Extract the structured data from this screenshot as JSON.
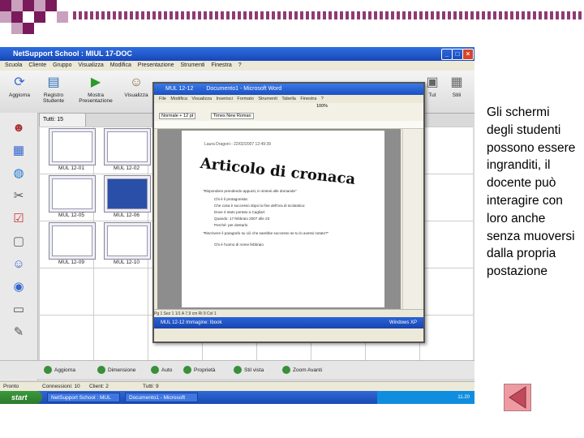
{
  "slide": {
    "caption": "Gli schermi degli studenti possono essere ingranditi, il docente può interagire con loro anche senza muoversi dalla propria postazione",
    "colors": {
      "accent": "#7a1a5a",
      "nav_button": "#ee9aa2"
    },
    "nav_icon": "previous-triangle-icon"
  },
  "app": {
    "title": "NetSupport School : MIUL 17-DOC",
    "menu": [
      "Scuola",
      "Cliente",
      "Gruppo",
      "Visualizza",
      "Modifica",
      "Presentazione",
      "Strumenti",
      "Finestra",
      "?"
    ],
    "toolbar": [
      {
        "label": "Aggiorna",
        "icon": "refresh-icon"
      },
      {
        "label": "Registro Studente",
        "icon": "register-icon"
      },
      {
        "label": "Mostra Presentazione",
        "icon": "play-icon"
      },
      {
        "label": "Visualizza",
        "icon": "view-icon"
      }
    ],
    "right_toolbar": [
      {
        "label": "Tut"
      },
      {
        "label": "Stili"
      }
    ],
    "tab_label": "Tutti: 15",
    "thumbnails": [
      "MUL 12-01",
      "MUL 12-02",
      "MUL 12-05",
      "MUL 12-06",
      "MUL 12-09",
      "MUL 12-10"
    ],
    "bottom_buttons": [
      "Aggiorna",
      "Dimensione",
      "Auto",
      "Proprietà",
      "Stil vista",
      "Zoom Avanti"
    ],
    "status": {
      "ready": "Pronto",
      "connections": "Connessioni: 10",
      "clients": "Client: 2",
      "total": "Tutti: 9"
    },
    "taskbar": {
      "start": "start",
      "tasks": [
        "NetSupport School : MUL 17-D...",
        "Documento1 - Microsoft Word"
      ],
      "tray": "11.20"
    }
  },
  "word_window": {
    "title": "MUL 12-12",
    "subtitle": "Documento1 - Microsoft Word",
    "menu": [
      "File",
      "Modifica",
      "Visualizza",
      "Inserisci",
      "Formato",
      "Strumenti",
      "Tabella",
      "Finestra",
      "?"
    ],
    "style_box": "Normale + 12 pt",
    "font_box": "Times New Roman",
    "zoom": "100%",
    "document": {
      "header": "Laura Dragoni - 22/02/2007 12:49:39",
      "title": "Articolo di cronaca",
      "lines": [
        "\"Rispondere prendendo appunti, in sintesi alle domande\"",
        "Chi è il protagonista:",
        "Che cosa è successo dopo la fine dell'ora di scolastica:",
        "Dove è stato portato a Cagliari:",
        "Quando: 17 febbraio 2007 alle 23",
        "Perché: per destarlo",
        "\"Riscrivere il paragrafo su ciò che sarebbe successo se tu lo avessi notato?\"",
        "Chi è l'uomo di nome febbraio"
      ]
    },
    "status_text": "Pg 1   Sez 1   1/1   A 7,9 cm   Ri 9   Col 1",
    "taskbar_text": "MUL 12-12   Immagine: Ibook",
    "os_label": "Windows XP"
  }
}
